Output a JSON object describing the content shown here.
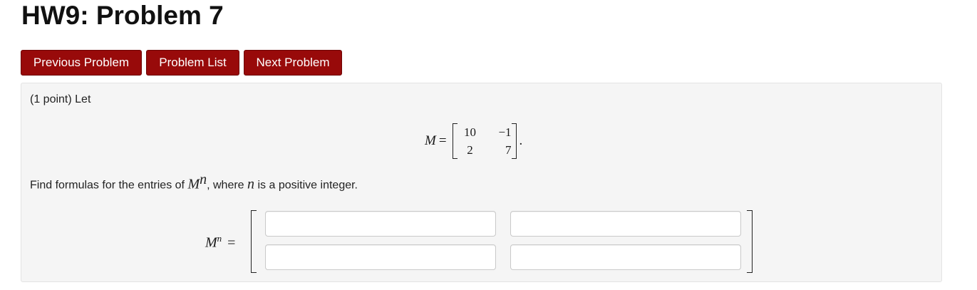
{
  "page": {
    "title": "HW9: Problem 7"
  },
  "nav": {
    "previous_label": "Previous Problem",
    "list_label": "Problem List",
    "next_label": "Next Problem"
  },
  "problem": {
    "intro": "(1 point) Let",
    "matrix_name": "M",
    "equals": "=",
    "matrix": [
      [
        "10",
        "−1"
      ],
      [
        "2",
        "7"
      ]
    ],
    "period": ".",
    "question_prefix": "Find formulas for the entries of ",
    "question_base": "M",
    "question_exp": "n",
    "question_mid": ", where ",
    "question_var": "n",
    "question_suffix": " is a positive integer."
  },
  "answer": {
    "label_base": "M",
    "label_exp": "n",
    "equals": "=",
    "entries": [
      [
        "",
        ""
      ],
      [
        "",
        ""
      ]
    ]
  },
  "colors": {
    "button_bg": "#980a0a",
    "panel_bg": "#f5f5f5"
  }
}
